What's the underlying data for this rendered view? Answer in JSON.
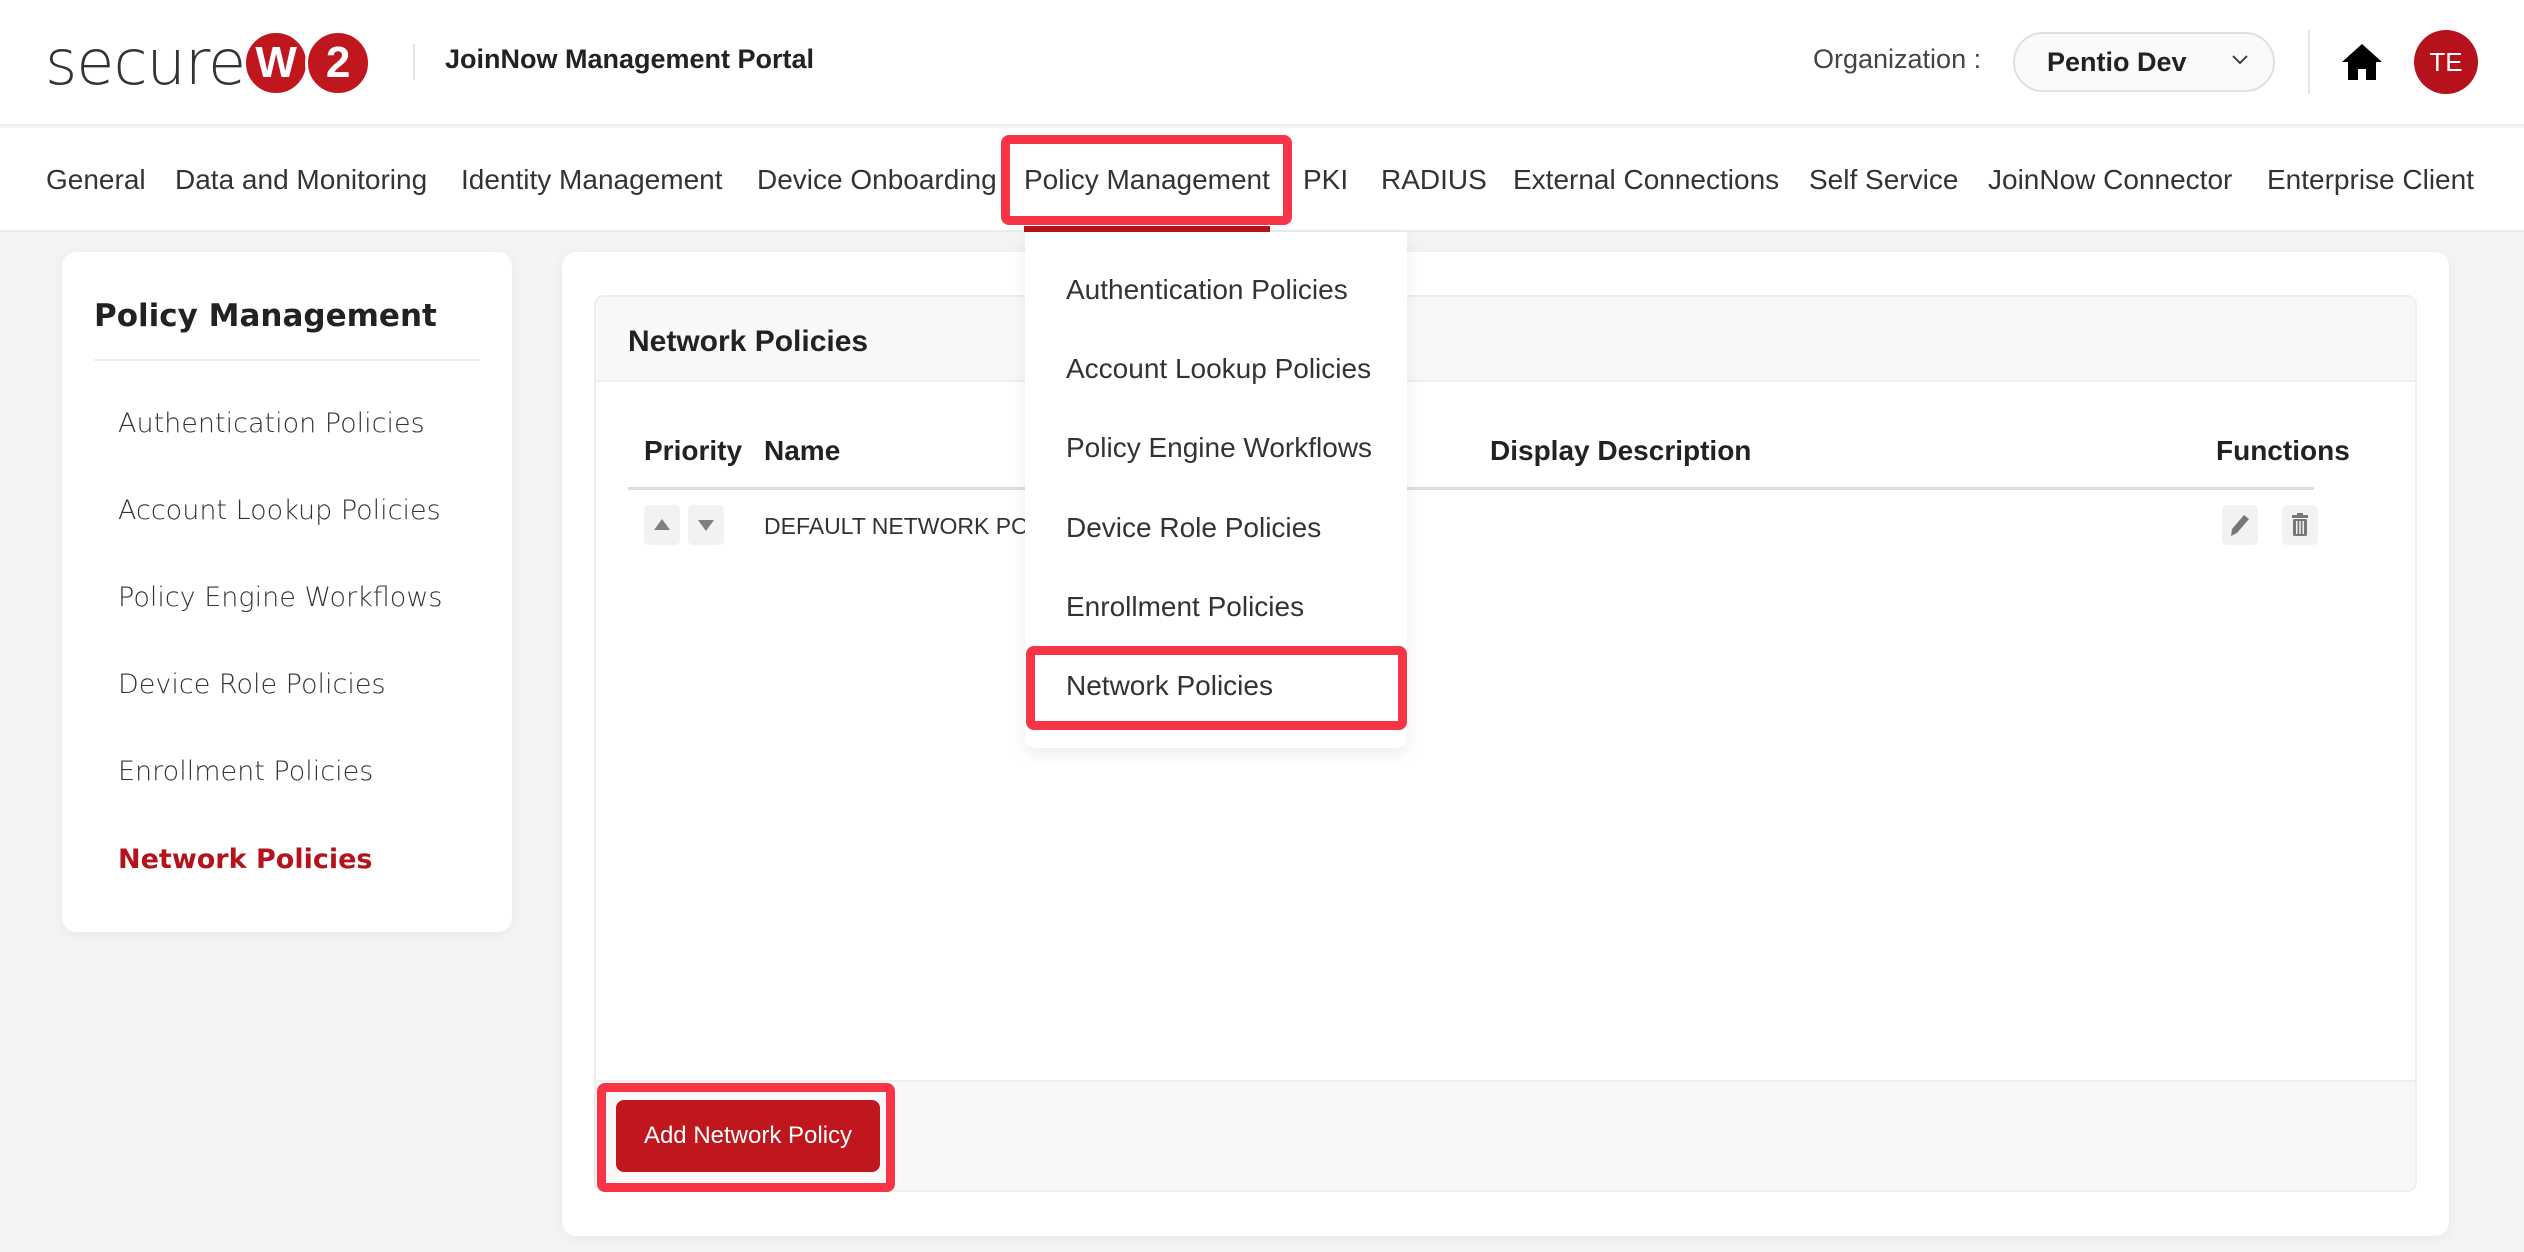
{
  "header": {
    "logo_text": "secure",
    "logo_badge_1": "W",
    "logo_badge_2": "2",
    "portal_title": "JoinNow Management Portal",
    "organization_label": "Organization :",
    "organization_value": "Pentio Dev",
    "avatar_initials": "TE"
  },
  "nav": {
    "items": [
      {
        "label": "General"
      },
      {
        "label": "Data and Monitoring"
      },
      {
        "label": "Identity Management"
      },
      {
        "label": "Device Onboarding"
      },
      {
        "label": "Policy Management",
        "active": true
      },
      {
        "label": "PKI"
      },
      {
        "label": "RADIUS"
      },
      {
        "label": "External Connections"
      },
      {
        "label": "Self Service"
      },
      {
        "label": "JoinNow Connector"
      },
      {
        "label": "Enterprise Client"
      }
    ]
  },
  "dropdown": {
    "items": [
      {
        "label": "Authentication Policies"
      },
      {
        "label": "Account Lookup Policies"
      },
      {
        "label": "Policy Engine Workflows"
      },
      {
        "label": "Device Role Policies"
      },
      {
        "label": "Enrollment Policies"
      },
      {
        "label": "Network Policies",
        "highlighted": true
      }
    ]
  },
  "sidebar": {
    "title": "Policy Management",
    "items": [
      {
        "label": "Authentication Policies"
      },
      {
        "label": "Account Lookup Policies"
      },
      {
        "label": "Policy Engine Workflows"
      },
      {
        "label": "Device Role Policies"
      },
      {
        "label": "Enrollment Policies"
      },
      {
        "label": "Network Policies",
        "active": true
      }
    ]
  },
  "main": {
    "panel_title": "Network Policies",
    "columns": [
      "Priority",
      "Name",
      "Display Description",
      "Functions"
    ],
    "rows": [
      {
        "name": "DEFAULT NETWORK POL",
        "display_description": ""
      }
    ],
    "add_button_label": "Add Network Policy"
  },
  "colors": {
    "brand_red": "#b5121b",
    "highlight_red": "#f73546"
  }
}
